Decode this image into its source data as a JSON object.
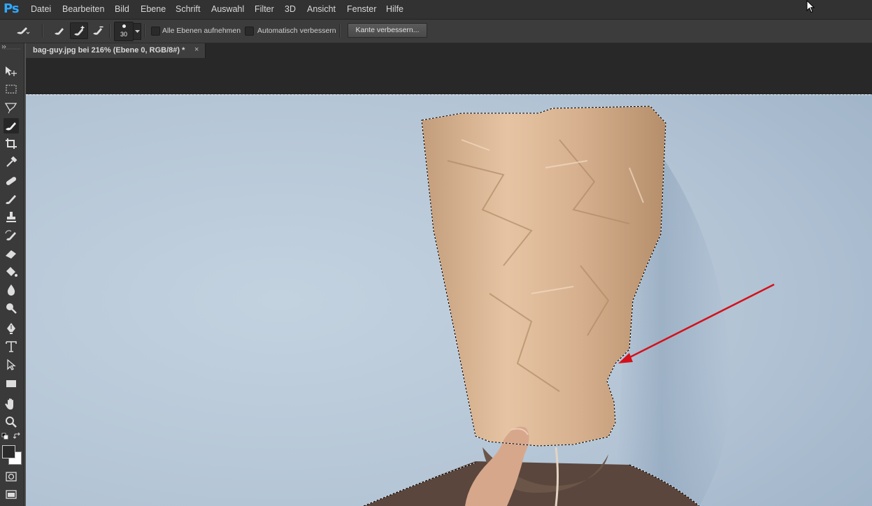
{
  "app": {
    "logo": "Ps"
  },
  "menu": {
    "items": [
      "Datei",
      "Bearbeiten",
      "Bild",
      "Ebene",
      "Schrift",
      "Auswahl",
      "Filter",
      "3D",
      "Ansicht",
      "Fenster",
      "Hilfe"
    ]
  },
  "options": {
    "brush_size": "30",
    "sample_all_layers_label": "Alle Ebenen aufnehmen",
    "auto_enhance_label": "Automatisch verbessern",
    "refine_edge_label": "Kante verbessern..."
  },
  "document": {
    "tab_title": "bag-guy.jpg bei 216% (Ebene 0, RGB/8#) *",
    "close_glyph": "×"
  },
  "colors": {
    "selection_tool_active": "#262626",
    "annotation_arrow": "#d4111a",
    "backdrop": "#b5c6d6"
  },
  "icons": {
    "toolbar": [
      "move-icon",
      "marquee-icon",
      "lasso-icon",
      "quick-selection-icon",
      "crop-icon",
      "eyedropper-icon",
      "healing-brush-icon",
      "brush-icon",
      "clone-stamp-icon",
      "history-brush-icon",
      "eraser-icon",
      "paint-bucket-icon",
      "blur-icon",
      "dodge-icon",
      "pen-icon",
      "type-icon",
      "path-selection-icon",
      "rectangle-icon",
      "hand-icon",
      "zoom-icon"
    ]
  }
}
